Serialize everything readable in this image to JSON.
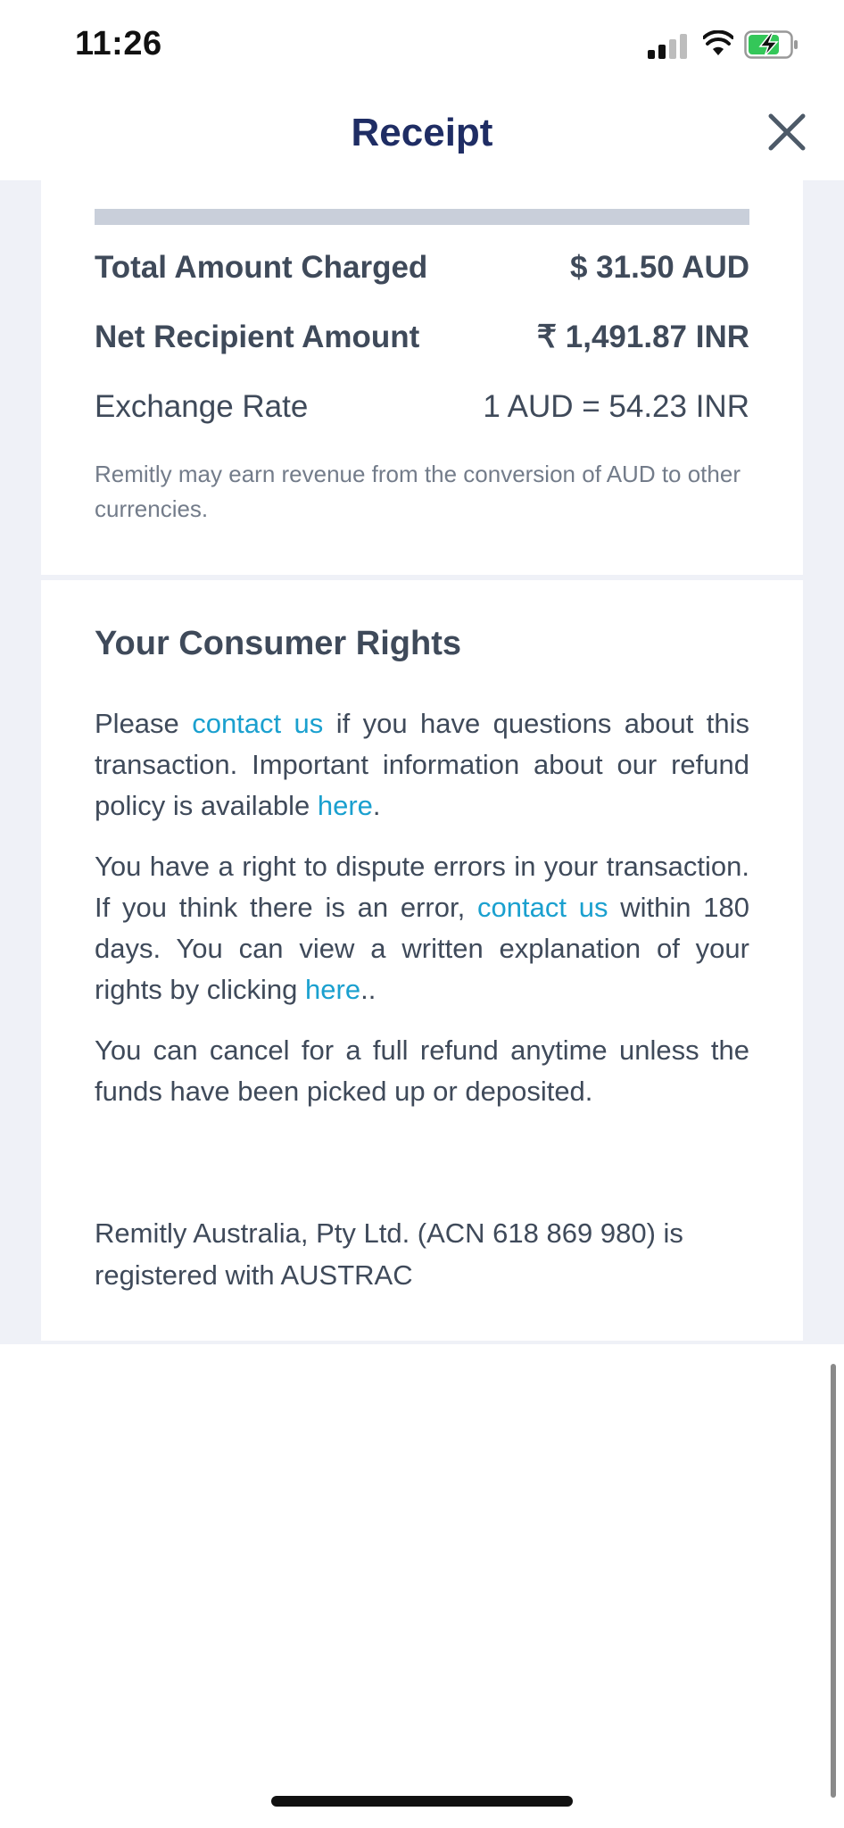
{
  "status_bar": {
    "time": "11:26"
  },
  "nav": {
    "title": "Receipt"
  },
  "summary": {
    "rows": [
      {
        "label": "Total Amount Charged",
        "value": "$ 31.50 AUD"
      },
      {
        "label": "Net Recipient Amount",
        "value": "₹ 1,491.87 INR"
      },
      {
        "label": "Exchange Rate",
        "value": "1 AUD = 54.23 INR"
      }
    ],
    "disclaimer": "Remitly may earn revenue from the conversion of AUD to other currencies."
  },
  "rights": {
    "title": "Your Consumer Rights",
    "p1": {
      "before": "Please ",
      "link1": "contact us",
      "mid": " if you have questions about this transaction. Important information about our refund policy is available ",
      "link2": "here",
      "after": "."
    },
    "p2": {
      "before": "You have a right to dispute errors in your transaction. If you think there is an error, ",
      "link1": "contact us",
      "mid": " within 180 days. You can view a written explanation of your rights by clicking ",
      "link2": "here",
      "after": ".."
    },
    "p3": "You can cancel for a full refund anytime unless the funds have been picked up or deposited."
  },
  "footer": {
    "registration": "Remitly Australia, Pty Ltd. (ACN 618 869 980) is registered with AUSTRAC"
  }
}
